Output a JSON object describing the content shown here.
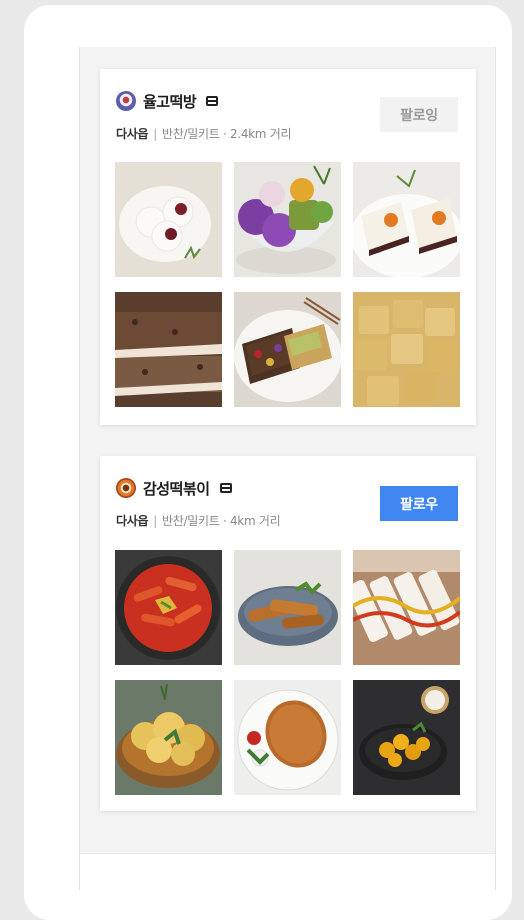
{
  "stores": [
    {
      "name": "율고떡방",
      "category": "다사읍",
      "detail": "반찬/밀키트 · 2.4km 거리",
      "follow_label": "팔로잉",
      "following": true,
      "avatar": "mochi-logo-icon",
      "photos": [
        "red-bean-mochi-photo",
        "colorful-rice-cake-bowl-photo",
        "layered-rice-cake-photo",
        "black-sesame-injeolmi-photo",
        "fruit-rice-cake-plate-photo",
        "injeolmi-cubes-photo"
      ]
    },
    {
      "name": "감성떡볶이",
      "category": "다사읍",
      "detail": "반찬/밀키트 · 4km 거리",
      "follow_label": "팔로우",
      "following": false,
      "avatar": "tteokbokki-logo-icon",
      "photos": [
        "tteokbokki-pan-photo",
        "fried-roll-plate-photo",
        "grilled-rice-cake-skewer-photo",
        "fried-vegetables-basket-photo",
        "pork-cutlet-plate-photo",
        "sweet-potato-tteokbokki-photo"
      ]
    }
  ],
  "colors": {
    "accent": "#3f86f1",
    "following_bg": "#f2f2f3",
    "following_text": "#9a9a9a"
  }
}
